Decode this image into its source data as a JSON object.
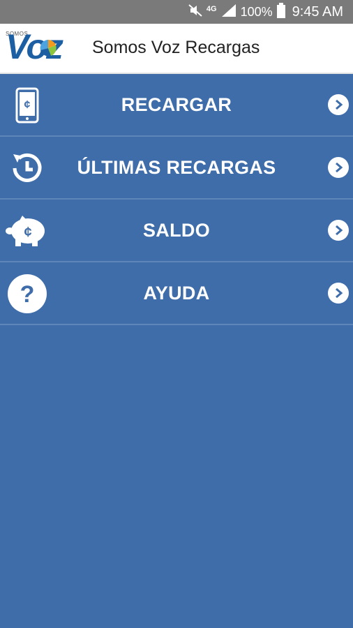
{
  "status_bar": {
    "network": "4G",
    "battery": "100%",
    "time": "9:45 AM",
    "icons": [
      "mute-icon",
      "signal-icon",
      "battery-icon"
    ]
  },
  "app_bar": {
    "logo_small": "SOMOS",
    "logo_big": "Voz",
    "title": "Somos Voz Recargas"
  },
  "menu": {
    "items": [
      {
        "label": "RECARGAR",
        "icon": "phone-colon-icon"
      },
      {
        "label": "ÚLTIMAS RECARGAS",
        "icon": "history-icon"
      },
      {
        "label": "SALDO",
        "icon": "piggy-bank-icon"
      },
      {
        "label": "AYUDA",
        "icon": "help-icon"
      }
    ]
  },
  "colors": {
    "background": "#3f6daa",
    "divider": "#5f86b8",
    "status_bar": "#7a7a7a",
    "brand": "#1d5fa3"
  }
}
